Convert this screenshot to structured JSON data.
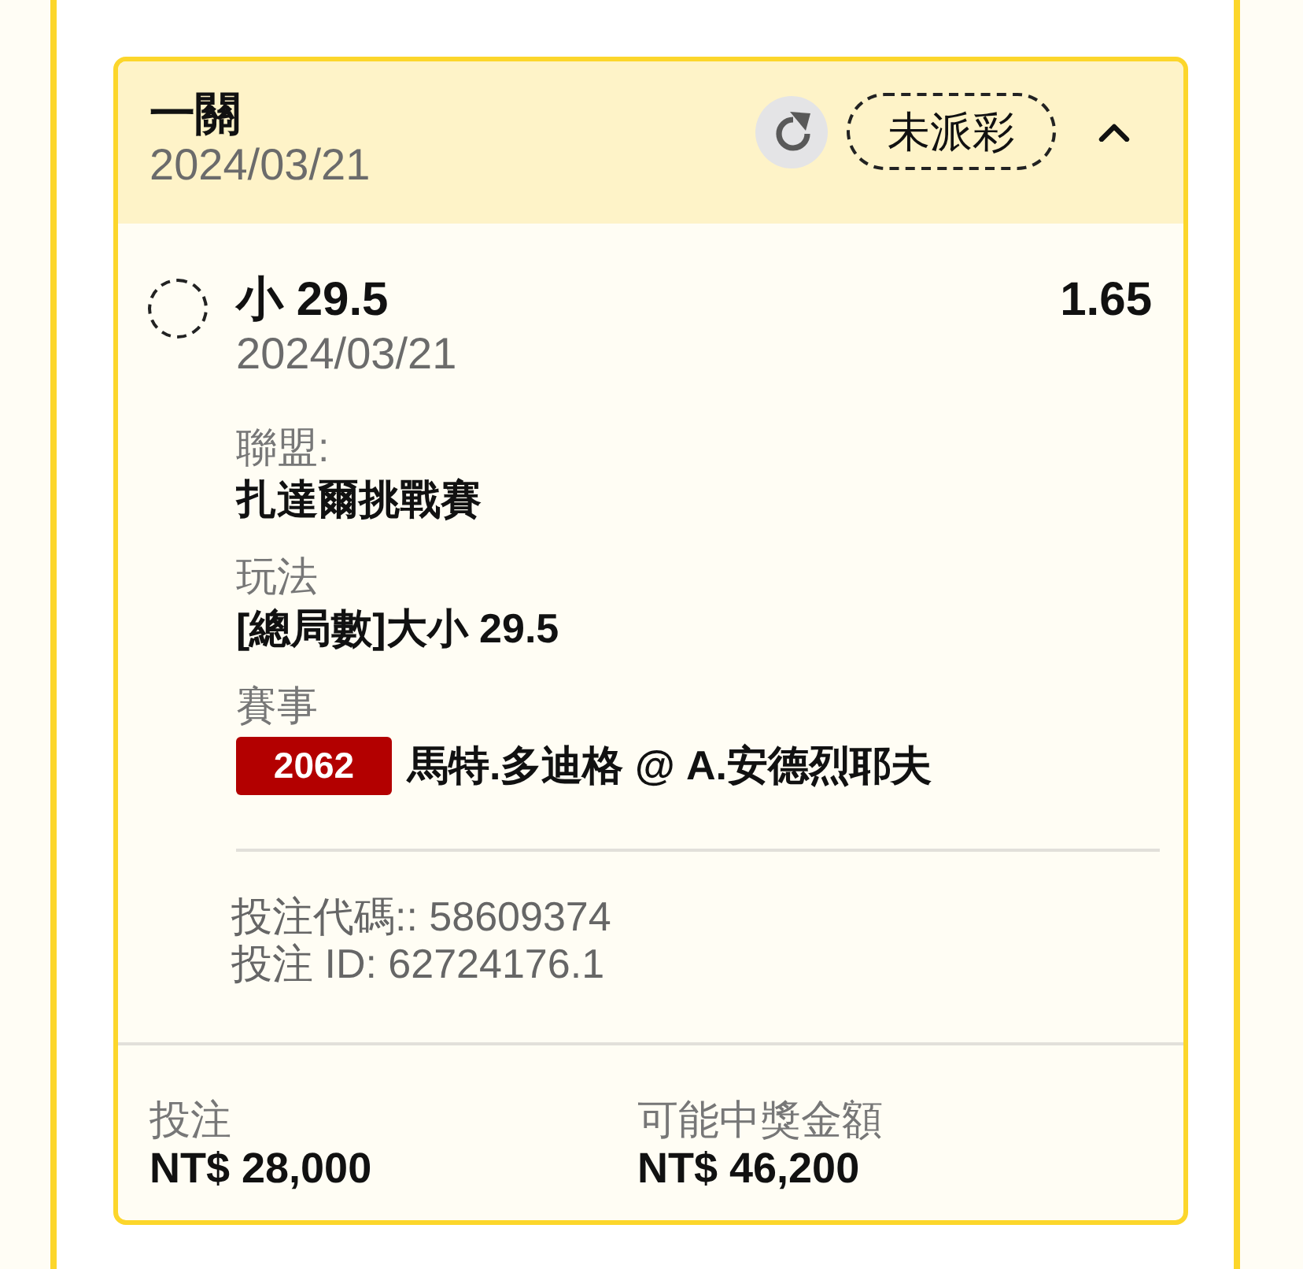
{
  "bet_card": {
    "title": "一關",
    "date": "2024/03/21",
    "status_badge": "未派彩",
    "expanded": true,
    "selections": [
      {
        "kind": "pending",
        "pick": "小 29.5",
        "odds": "1.65",
        "date": "2024/03/21",
        "details": [
          {
            "label": "聯盟:",
            "value": "扎達爾挑戰賽"
          },
          {
            "label": "玩法",
            "value": "[總局數]大小 29.5"
          },
          {
            "label": "賽事",
            "tag": "2062",
            "value": "馬特.多迪格 @ A.安德烈耶夫"
          }
        ],
        "codes": [
          "投注代碼:: 58609374",
          "投注 ID: 62724176.1"
        ]
      }
    ],
    "totals": [
      {
        "label": "投注",
        "value": "NT$ 28,000"
      },
      {
        "label": "可能中獎金額",
        "value": "NT$ 46,200"
      }
    ]
  }
}
